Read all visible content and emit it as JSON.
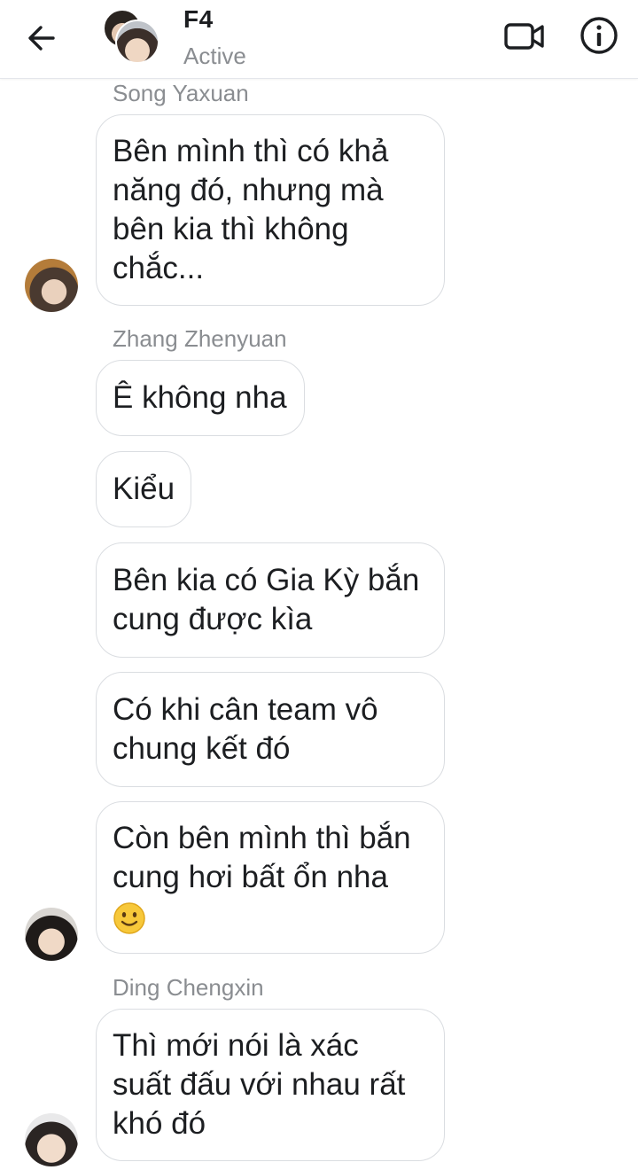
{
  "header": {
    "title": "F4",
    "status": "Active",
    "back_icon": "arrow-left-icon",
    "video_icon": "video-camera-icon",
    "info_icon": "info-icon"
  },
  "messages": [
    {
      "sender": "Song Yaxuan",
      "text": "Bên mình thì có khả\nnăng đó, nhưng mà\nbên kia thì không\nchắc..."
    },
    {
      "sender": "Zhang Zhenyuan",
      "text": "Ê không nha"
    },
    {
      "text": "Kiểu"
    },
    {
      "text": "Bên kia có Gia Kỳ bắn\ncung được kìa"
    },
    {
      "text": "Có khi cân team vô\nchung kết đó"
    },
    {
      "text": "Còn bên mình thì bắn\ncung hơi bất ổn nha",
      "emoji": "slightly-smiling-face-icon"
    },
    {
      "sender": "Ding Chengxin",
      "text": "Thì mới nói là xác\nsuất đấu với nhau rất\nkhó đó"
    }
  ],
  "colors": {
    "bubble_border": "#dadde1",
    "secondary_text": "#8a8d91",
    "primary_text": "#1c1e21"
  }
}
